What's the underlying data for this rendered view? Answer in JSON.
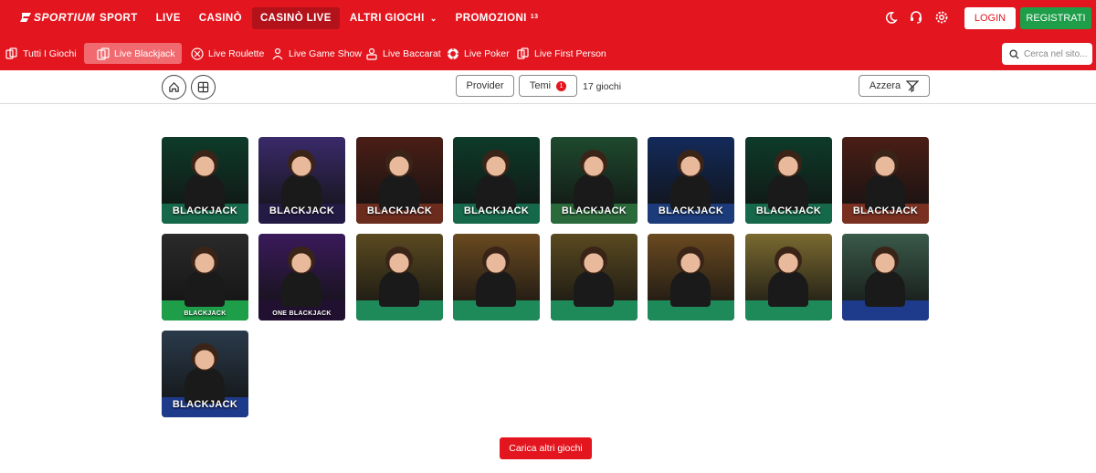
{
  "brand": {
    "logo_text": "SPORTIUM",
    "accent": "#e3161f",
    "green": "#1e9e49"
  },
  "top_nav": {
    "items": [
      {
        "label": "SPORT"
      },
      {
        "label": "LIVE"
      },
      {
        "label": "CASINÒ"
      },
      {
        "label": "CASINÒ LIVE",
        "active": true
      },
      {
        "label": "ALTRI GIOCHI",
        "dropdown": true
      },
      {
        "label": "PROMOZIONI",
        "badge": "13"
      }
    ],
    "icons": [
      "moon-icon",
      "headset-icon",
      "settings-icon"
    ],
    "login": "LOGIN",
    "register": "REGISTRATI"
  },
  "sub_nav": {
    "items": [
      {
        "label": "Tutti I Giochi",
        "icon": "cards-icon"
      },
      {
        "label": "Live Blackjack",
        "icon": "blackjack-icon",
        "active": true
      },
      {
        "label": "Live Roulette",
        "icon": "roulette-icon"
      },
      {
        "label": "Live Game Show",
        "icon": "game-show-icon"
      },
      {
        "label": "Live Baccarat",
        "icon": "baccarat-icon"
      },
      {
        "label": "Live Poker",
        "icon": "poker-chip-icon"
      },
      {
        "label": "Live First Person",
        "icon": "first-person-icon"
      }
    ],
    "search_placeholder": "Cerca nel sito..."
  },
  "filters": {
    "provider": "Provider",
    "themes": "Temi",
    "themes_badge": "1",
    "count": "17 giochi",
    "reset": "Azzera"
  },
  "games": [
    {
      "label": "BLACKJACK",
      "bg": "#0e3b2a",
      "table": "#16684a"
    },
    {
      "label": "BLACKJACK",
      "bg": "#3a2a6a",
      "table": "#241b45"
    },
    {
      "label": "BLACKJACK",
      "bg": "#4a1e16",
      "table": "#6b2c1e"
    },
    {
      "label": "BLACKJACK",
      "bg": "#0e3b2a",
      "table": "#16684a"
    },
    {
      "label": "BLACKJACK",
      "bg": "#1e4a2e",
      "table": "#2a6a3a"
    },
    {
      "label": "BLACKJACK",
      "bg": "#132a5a",
      "table": "#1b3b7a"
    },
    {
      "label": "BLACKJACK",
      "bg": "#0e3b2a",
      "table": "#16684a"
    },
    {
      "label": "BLACKJACK",
      "bg": "#4a1e16",
      "table": "#7a3020"
    },
    {
      "label": "BLACKJACK",
      "bg": "#2a2a2a",
      "table": "#1e9e49",
      "small": true
    },
    {
      "label": "ONE BLACKJACK",
      "bg": "#3a1a5a",
      "table": "#221030",
      "small": true
    },
    {
      "label": "",
      "bg": "#5a4a20",
      "table": "#1e8a5a"
    },
    {
      "label": "",
      "bg": "#6a4a20",
      "table": "#1e8a5a"
    },
    {
      "label": "",
      "bg": "#5a4a20",
      "table": "#1e8a5a"
    },
    {
      "label": "",
      "bg": "#6a4a20",
      "table": "#1e8a5a"
    },
    {
      "label": "",
      "bg": "#7a6a30",
      "table": "#1e8a5a"
    },
    {
      "label": "",
      "bg": "#3a5a4a",
      "table": "#1e3a8a"
    },
    {
      "label": "BLACKJACK",
      "bg": "#2a3a4a",
      "table": "#1e3a8a"
    }
  ],
  "load_more": "Carica altri giochi"
}
